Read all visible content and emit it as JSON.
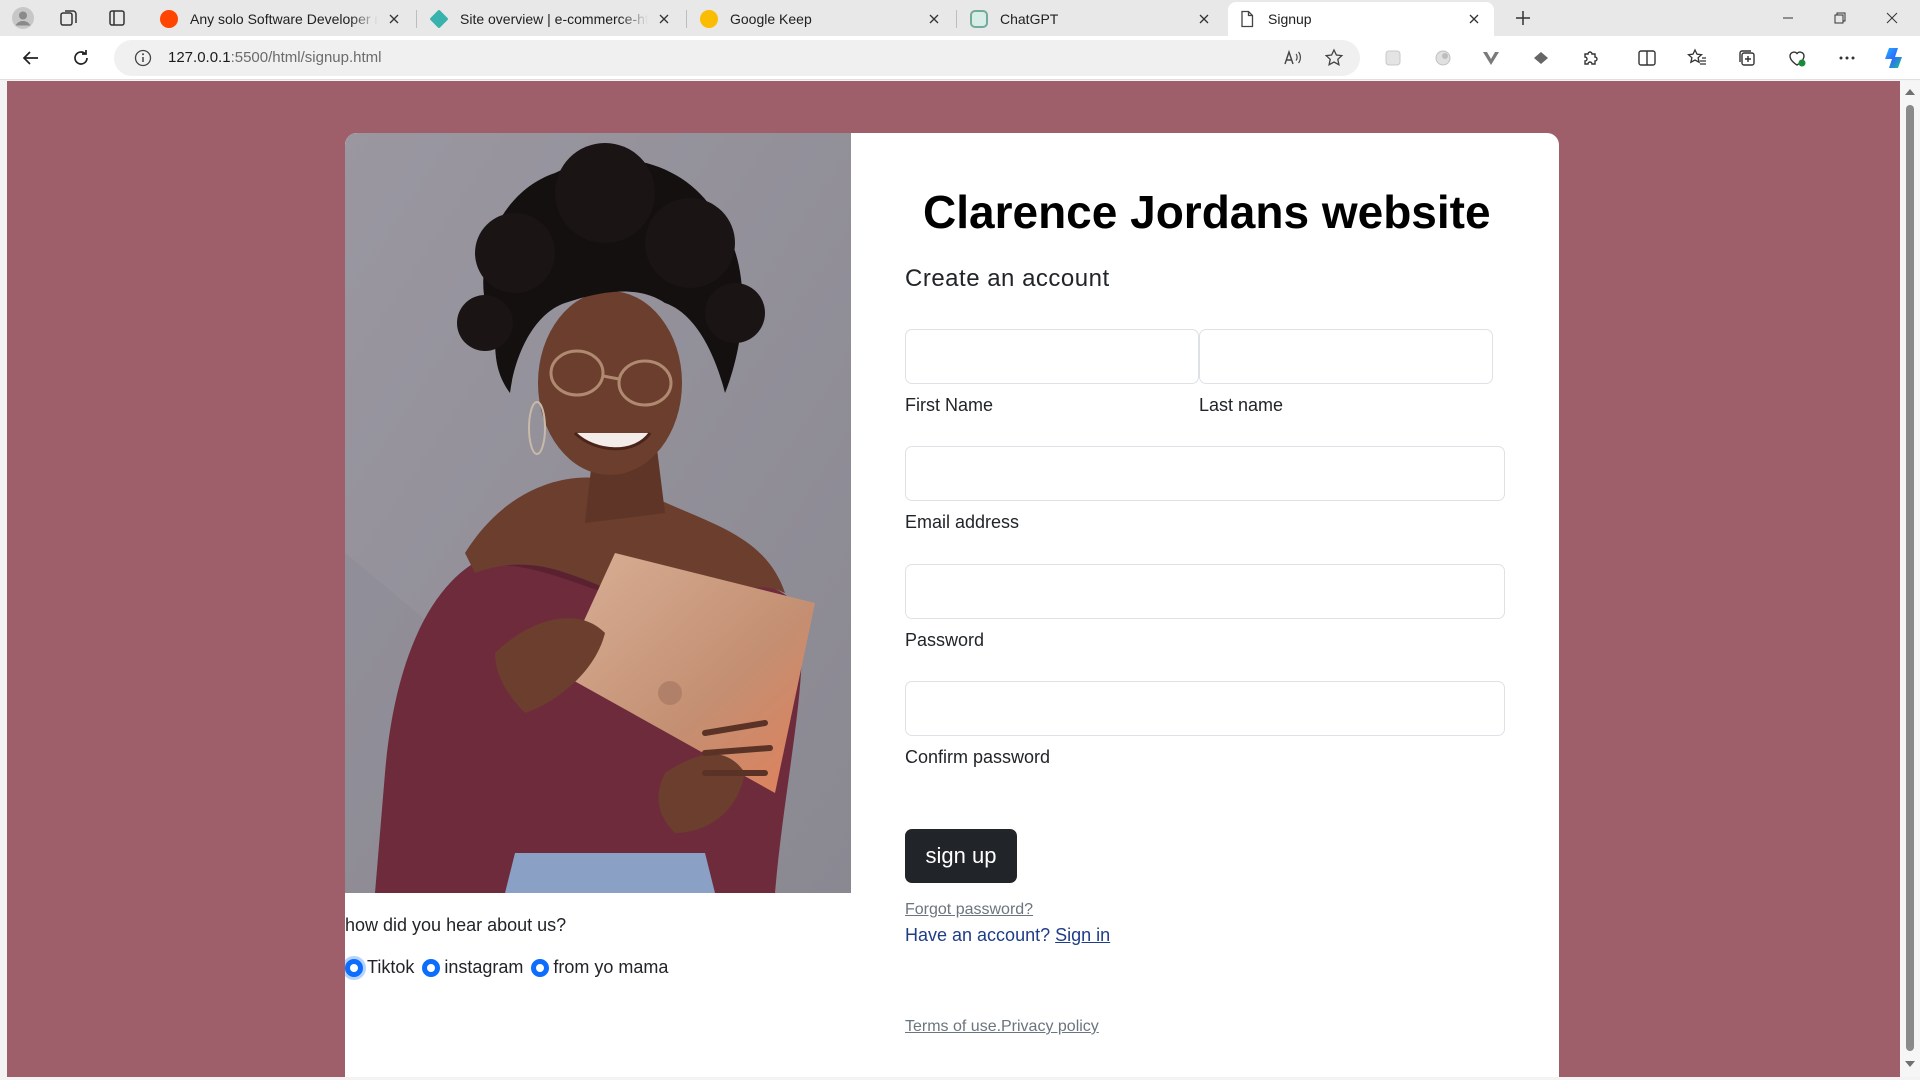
{
  "browser": {
    "tabs": [
      {
        "title": "Any solo Software Developer ma",
        "favicon_color": "#ff4500",
        "active": false
      },
      {
        "title": "Site overview | e-commerce-htm",
        "favicon_color": "#38b2ac",
        "active": false
      },
      {
        "title": "Google Keep",
        "favicon_color": "#fbbc04",
        "active": false
      },
      {
        "title": "ChatGPT",
        "favicon_color": "#74aa9c",
        "active": false
      },
      {
        "title": "Signup",
        "favicon_color": "#5f6368",
        "active": true
      }
    ],
    "url_host": "127.0.0.1",
    "url_rest": ":5500/html/signup.html"
  },
  "page": {
    "background_color": "#9e5f6b",
    "title": "Clarence Jordans website",
    "subtitle": "Create an account",
    "fields": {
      "first_name": {
        "label": "First Name",
        "value": ""
      },
      "last_name": {
        "label": "Last name",
        "value": ""
      },
      "email": {
        "label": "Email address",
        "value": ""
      },
      "password": {
        "label": "Password",
        "value": ""
      },
      "confirm_password": {
        "label": "Confirm password",
        "value": ""
      }
    },
    "signup_button": "sign up",
    "forgot_password": "Forgot password?",
    "have_account": "Have an account?",
    "sign_in": "Sign in",
    "terms": "Terms of use.",
    "privacy": "Privacy policy",
    "hear_question": "how did you hear about us?",
    "hear_options": [
      "Tiktok",
      "instagram",
      "from yo mama"
    ],
    "accent_color": "#0d6efd",
    "button_color": "#212529"
  }
}
